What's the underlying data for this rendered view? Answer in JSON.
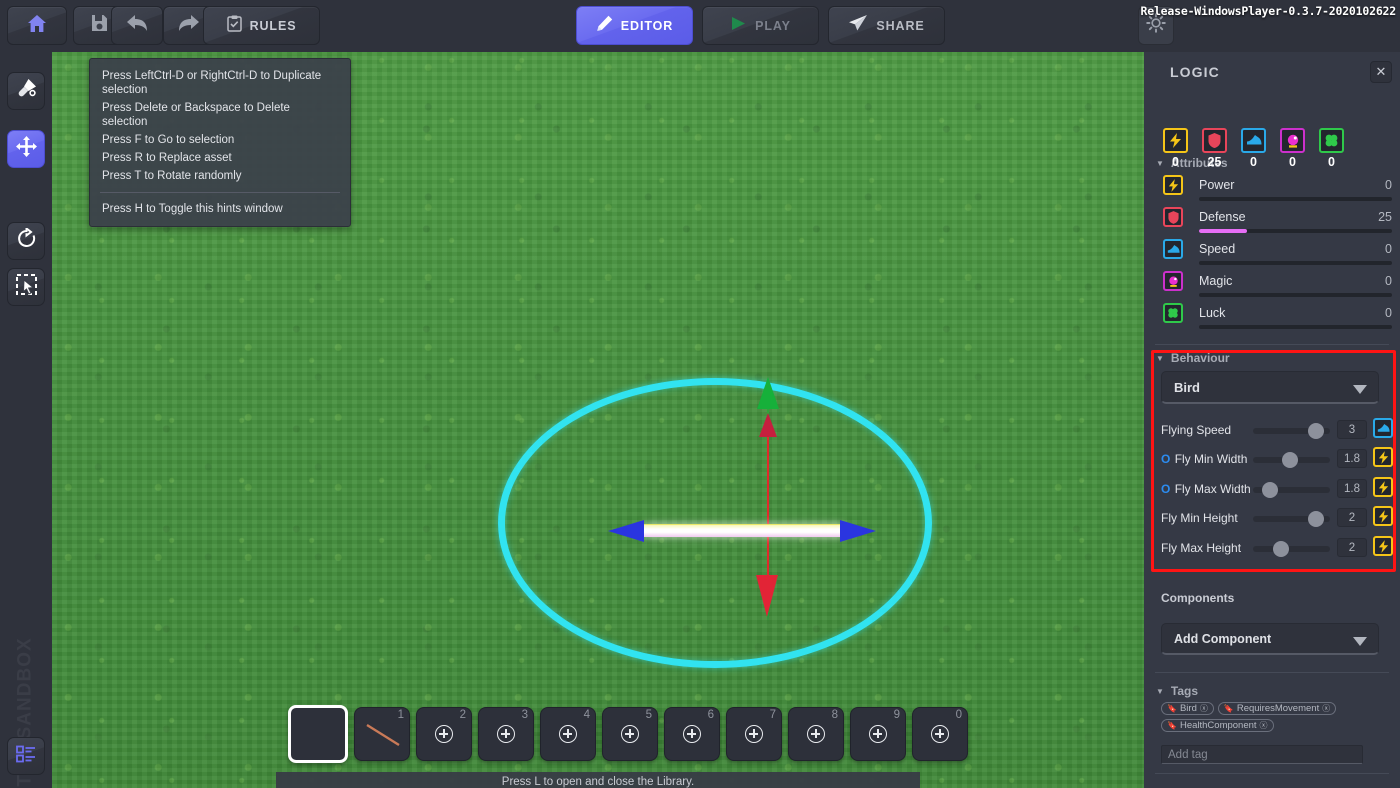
{
  "topbar": {
    "home_label": "Home",
    "save_label": "Save",
    "undo_label": "Undo",
    "redo_label": "Redo",
    "rules_label": "RULES",
    "editor_label": "EDITOR",
    "play_label": "PLAY",
    "share_label": "SHARE",
    "settings_label": "Settings",
    "version": "Release-WindowsPlayer-0.3.7-2020102622"
  },
  "sidebar": {
    "watermark": "THE SANDBOX",
    "tools": [
      {
        "name": "paint-tool",
        "icon": "paintbrush-icon",
        "active": false
      },
      {
        "name": "move-tool",
        "icon": "move-icon",
        "active": true
      },
      {
        "name": "rotate-tool",
        "icon": "rotate-icon",
        "active": false
      },
      {
        "name": "select-tool",
        "icon": "select-cursor-icon",
        "active": false
      },
      {
        "name": "layers-tool",
        "icon": "layers-list-icon",
        "active": false
      }
    ]
  },
  "hints": {
    "lines": [
      "Press LeftCtrl-D or RightCtrl-D to Duplicate selection",
      "Press Delete or Backspace to Delete selection",
      "Press F to Go to selection",
      "Press R to Replace asset",
      "Press T to Rotate randomly"
    ],
    "toggle_line": "Press H to Toggle this hints window"
  },
  "statusbar": {
    "text": "Press L to open and close the Library."
  },
  "assetbar": {
    "slots": [
      {
        "num": "",
        "type": "selected-empty"
      },
      {
        "num": "1",
        "type": "asset-line"
      },
      {
        "num": "2",
        "type": "empty"
      },
      {
        "num": "3",
        "type": "empty"
      },
      {
        "num": "4",
        "type": "empty"
      },
      {
        "num": "5",
        "type": "empty"
      },
      {
        "num": "6",
        "type": "empty"
      },
      {
        "num": "7",
        "type": "empty"
      },
      {
        "num": "8",
        "type": "empty"
      },
      {
        "num": "9",
        "type": "empty"
      },
      {
        "num": "0",
        "type": "empty"
      }
    ]
  },
  "panel": {
    "title": "LOGIC",
    "close_label": "✕",
    "attributes_header": "Attributes",
    "attribute_chips": [
      {
        "icon": "power-lightning-icon",
        "value": "0",
        "color": "#f5c518"
      },
      {
        "icon": "defense-shield-icon",
        "value": "25",
        "color": "#e8455a"
      },
      {
        "icon": "speed-shoe-icon",
        "value": "0",
        "color": "#2aa9e8"
      },
      {
        "icon": "magic-potion-icon",
        "value": "0",
        "color": "#cc30cc"
      },
      {
        "icon": "luck-clover-icon",
        "value": "0",
        "color": "#2fc94a"
      }
    ],
    "attributes": [
      {
        "icon": "power-lightning-icon",
        "label": "Power",
        "value": "0",
        "fill_pct": 0
      },
      {
        "icon": "defense-shield-icon",
        "label": "Defense",
        "value": "25",
        "fill_pct": 25
      },
      {
        "icon": "speed-shoe-icon",
        "label": "Speed",
        "value": "0",
        "fill_pct": 0
      },
      {
        "icon": "magic-potion-icon",
        "label": "Magic",
        "value": "0",
        "fill_pct": 0
      },
      {
        "icon": "luck-clover-icon",
        "label": "Luck",
        "value": "0",
        "fill_pct": 0
      }
    ],
    "behaviour_header": "Behaviour",
    "behaviour_selected": "Bird",
    "behaviour_props": [
      {
        "label": "Flying Speed",
        "prefix": "",
        "value": "3",
        "slider_pct": 82,
        "icon": "speed-shoe-icon"
      },
      {
        "label": "Fly Min Width",
        "prefix": "O",
        "value": "1.8",
        "slider_pct": 48,
        "icon": "power-lightning-icon"
      },
      {
        "label": "Fly Max Width",
        "prefix": "O",
        "value": "1.8",
        "slider_pct": 22,
        "icon": "power-lightning-icon"
      },
      {
        "label": "Fly Min Height",
        "prefix": "",
        "value": "2",
        "slider_pct": 82,
        "icon": "power-lightning-icon"
      },
      {
        "label": "Fly Max Height",
        "prefix": "",
        "value": "2",
        "slider_pct": 36,
        "icon": "power-lightning-icon"
      }
    ],
    "components_label": "Components",
    "add_component_label": "Add Component",
    "tags_header": "Tags",
    "tags": [
      "Bird",
      "RequiresMovement",
      "HealthComponent"
    ],
    "add_tag_placeholder": "Add tag",
    "highlight_color": "#ff1414"
  }
}
